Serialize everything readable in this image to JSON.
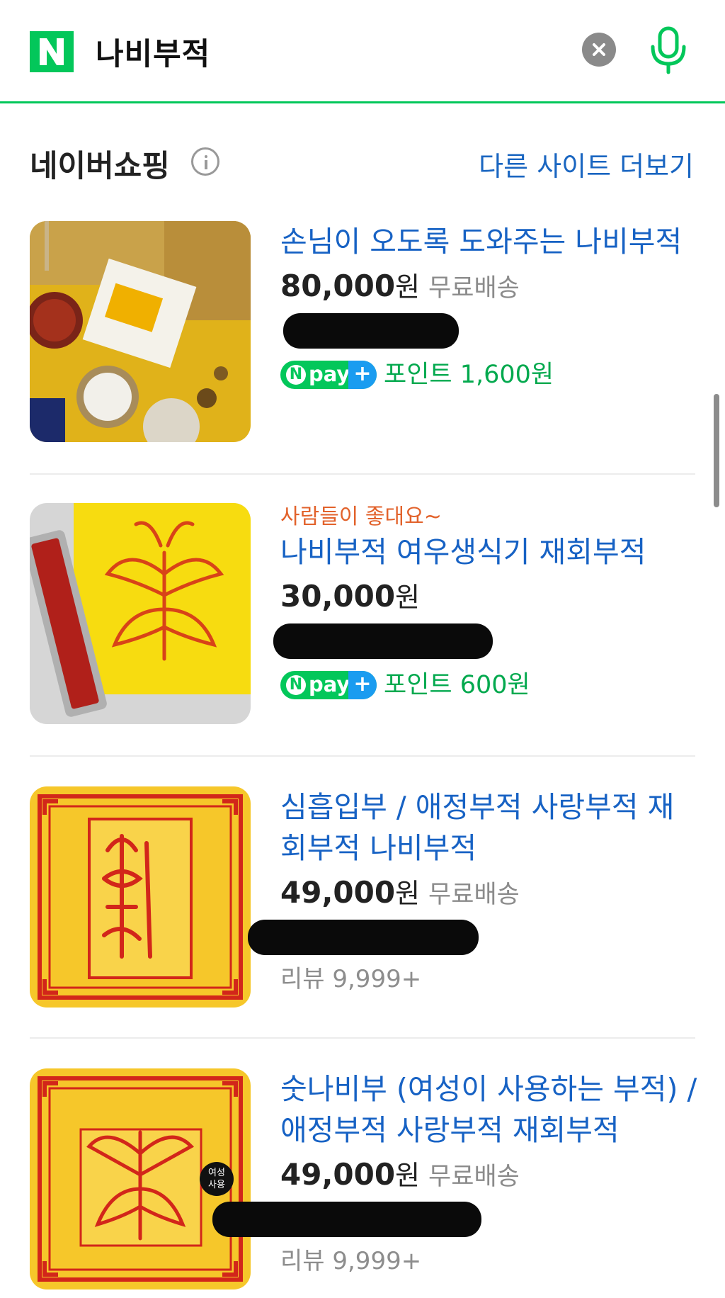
{
  "search": {
    "query": "나비부적"
  },
  "section": {
    "title": "네이버쇼핑",
    "more_link": "다른 사이트 더보기"
  },
  "npay": {
    "n": "N",
    "pay": "pay",
    "plus": "+"
  },
  "products": [
    {
      "promo": "",
      "title": "손님이 오도록 도와주는 나비부적",
      "price": "80,000",
      "currency": "원",
      "shipping": "무료배송",
      "points": "포인트 1,600원",
      "review": ""
    },
    {
      "promo": "사람들이 좋대요~",
      "title": "나비부적 여우생식기 재회부적",
      "price": "30,000",
      "currency": "원",
      "shipping": "",
      "points": "포인트 600원",
      "review": ""
    },
    {
      "promo": "",
      "title": "심흡입부 / 애정부적 사랑부적 재회부적 나비부적",
      "price": "49,000",
      "currency": "원",
      "shipping": "무료배송",
      "points": "",
      "review": "리뷰 9,999+"
    },
    {
      "promo": "",
      "title": "숫나비부 (여성이 사용하는 부적) / 애정부적 사랑부적 재회부적",
      "price": "49,000",
      "currency": "원",
      "shipping": "무료배송",
      "points": "",
      "review": "리뷰 9,999+",
      "badge_line1": "여성",
      "badge_line2": "사용"
    }
  ],
  "colors": {
    "brand_green": "#03c75a",
    "link_blue": "#1762c4",
    "promo_orange": "#e2622b",
    "point_green": "#03a94e"
  }
}
